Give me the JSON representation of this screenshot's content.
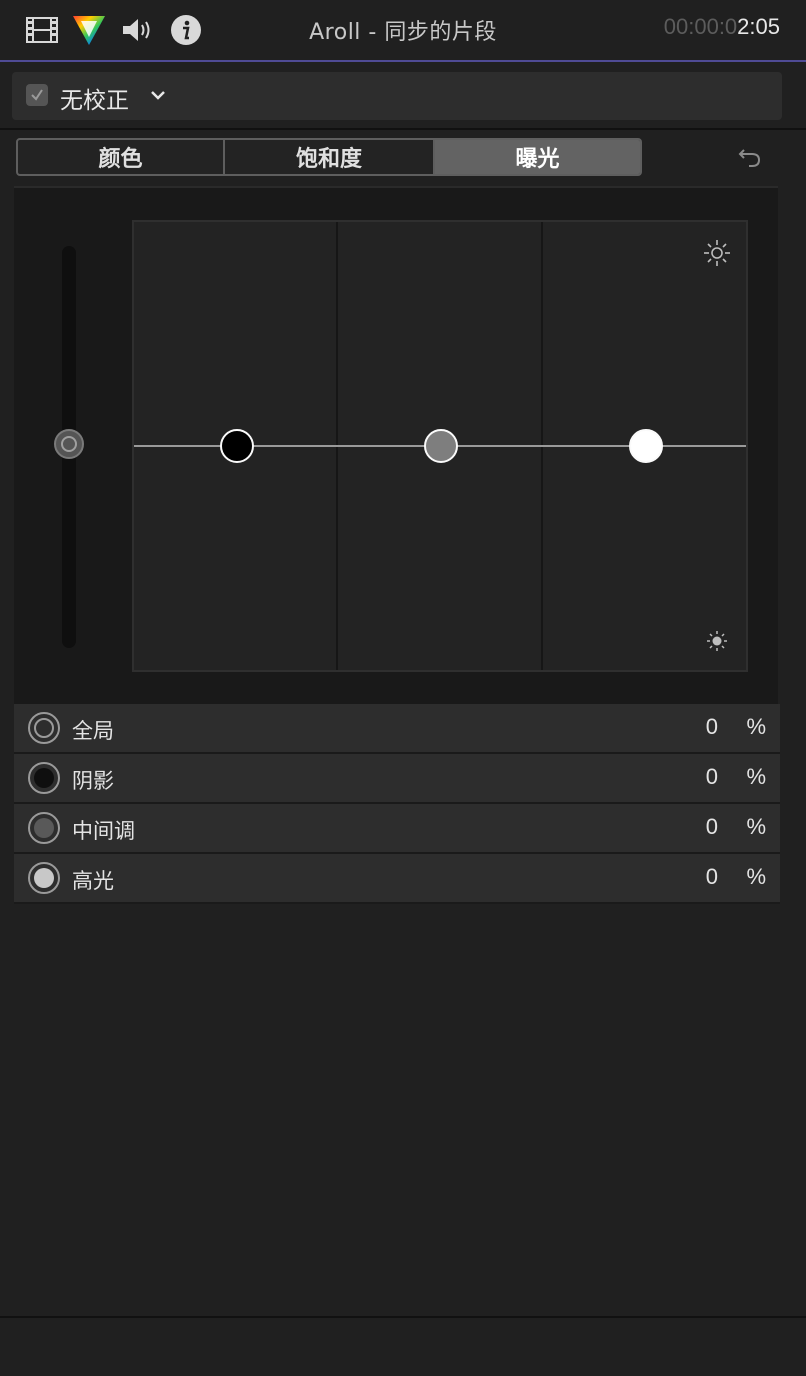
{
  "header": {
    "title": "Aroll - 同步的片段",
    "timecode_dim": "00:00:0",
    "timecode_bright": "2:05",
    "icons": [
      "film-icon",
      "color-prism-icon",
      "speaker-icon",
      "info-icon"
    ]
  },
  "correction": {
    "label": "无校正",
    "enabled": true
  },
  "tabs": [
    {
      "label": "颜色",
      "active": false
    },
    {
      "label": "饱和度",
      "active": false
    },
    {
      "label": "曝光",
      "active": true
    }
  ],
  "board": {
    "pucks": [
      {
        "name": "shadows",
        "color": "#000000",
        "value": 0
      },
      {
        "name": "midtones",
        "color": "#7e7e7e",
        "value": 0
      },
      {
        "name": "highlights",
        "color": "#ffffff",
        "value": 0
      }
    ],
    "master_value": 0
  },
  "rows": [
    {
      "label": "全局",
      "value": "0",
      "unit": "%",
      "dot": "none"
    },
    {
      "label": "阴影",
      "value": "0",
      "unit": "%",
      "dot": "#0f0f0f"
    },
    {
      "label": "中间调",
      "value": "0",
      "unit": "%",
      "dot": "#595959"
    },
    {
      "label": "高光",
      "value": "0",
      "unit": "%",
      "dot": "#c8c8c8"
    }
  ],
  "colors": {
    "accent_line": "#4f4b95",
    "background": "#202020",
    "panel": "#2d2d2d"
  }
}
